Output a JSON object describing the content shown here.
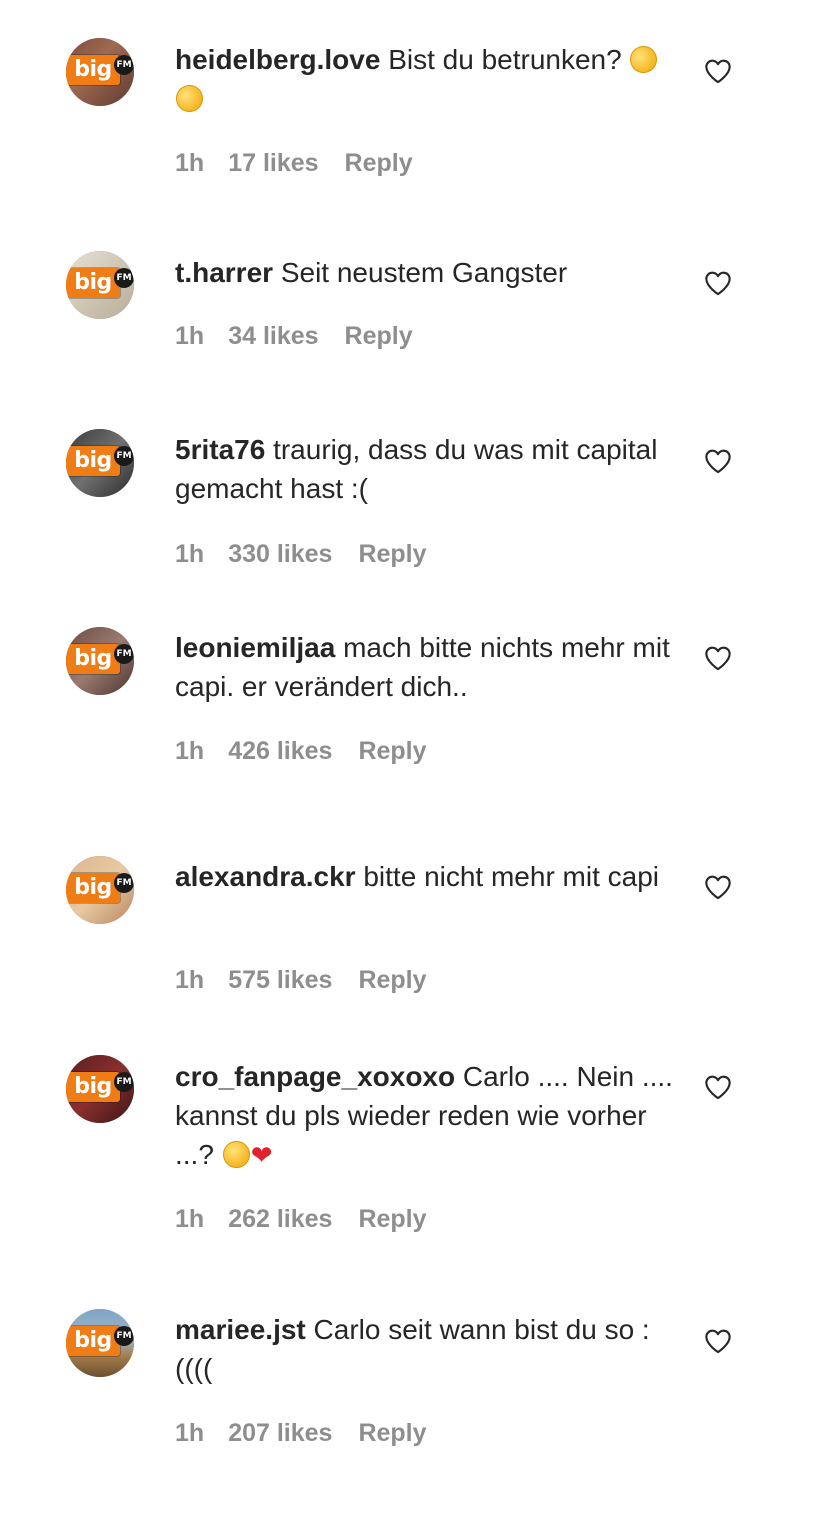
{
  "comments": [
    {
      "username": "heidelberg.love",
      "text": "Bist du betrunken?",
      "emoji": "rofl-emoji x2",
      "time": "1h",
      "likes": "17 likes",
      "reply": "Reply",
      "avatar_badge": "big",
      "avatar_fm": "FM"
    },
    {
      "username": "t.harrer",
      "text": "Seit neustem Gangster",
      "time": "1h",
      "likes": "34 likes",
      "reply": "Reply",
      "avatar_badge": "big",
      "avatar_fm": "FM"
    },
    {
      "username": "5rita76",
      "text": "traurig, dass du was mit capital gemacht hast :(",
      "time": "1h",
      "likes": "330 likes",
      "reply": "Reply",
      "avatar_badge": "big",
      "avatar_fm": "FM"
    },
    {
      "username": "leoniemiljaa",
      "text": "mach bitte nichts mehr mit capi. er verändert dich..",
      "time": "1h",
      "likes": "426 likes",
      "reply": "Reply",
      "avatar_badge": "big",
      "avatar_fm": "FM"
    },
    {
      "username": "alexandra.ckr",
      "text": "bitte nicht mehr mit capi",
      "time": "1h",
      "likes": "575 likes",
      "reply": "Reply",
      "avatar_badge": "big",
      "avatar_fm": "FM"
    },
    {
      "username": "cro_fanpage_xoxoxo",
      "text": "Carlo .... Nein .... kannst du pls wieder reden wie vorher ...?",
      "emoji": "joy-emoji, red-heart-emoji",
      "time": "1h",
      "likes": "262 likes",
      "reply": "Reply",
      "avatar_badge": "big",
      "avatar_fm": "FM"
    },
    {
      "username": "mariee.jst",
      "text": "Carlo seit wann bist du so :((((",
      "time": "1h",
      "likes": "207 likes",
      "reply": "Reply",
      "avatar_badge": "big",
      "avatar_fm": "FM"
    }
  ],
  "colors": {
    "text": "#262626",
    "meta": "#8e8e8e",
    "badge": "#f07c15",
    "heart_outline": "#262626"
  },
  "icons": {
    "like": "heart-outline-icon"
  }
}
